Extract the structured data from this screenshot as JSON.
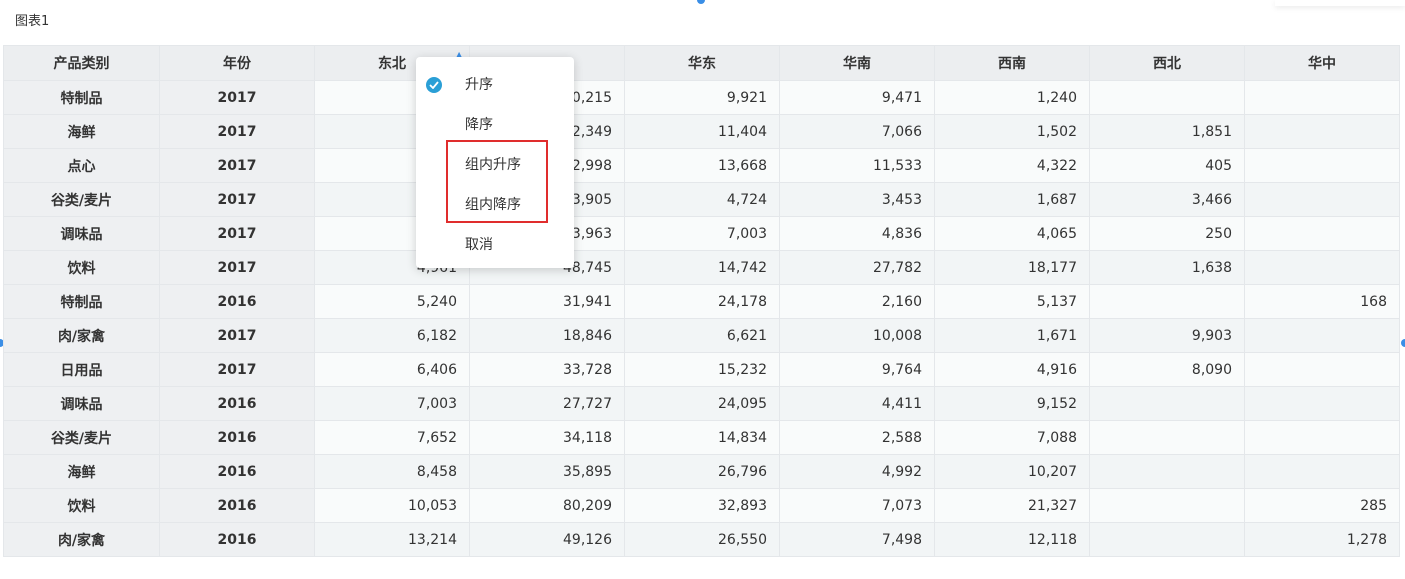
{
  "chart_title": "图表1",
  "colors": {
    "accent": "#2a9fd6",
    "highlight": "#e02d2d"
  },
  "columns": [
    "产品类别",
    "年份",
    "东北",
    "",
    "华东",
    "华南",
    "西南",
    "西北",
    "华中"
  ],
  "rows": [
    [
      "特制品",
      "2017",
      "",
      "0,215",
      "9,921",
      "9,471",
      "1,240",
      "",
      ""
    ],
    [
      "海鲜",
      "2017",
      "",
      "2,349",
      "11,404",
      "7,066",
      "1,502",
      "1,851",
      ""
    ],
    [
      "点心",
      "2017",
      "",
      "2,998",
      "13,668",
      "11,533",
      "4,322",
      "405",
      ""
    ],
    [
      "谷类/麦片",
      "2017",
      "",
      "3,905",
      "4,724",
      "3,453",
      "1,687",
      "3,466",
      ""
    ],
    [
      "调味品",
      "2017",
      "",
      "3,963",
      "7,003",
      "4,836",
      "4,065",
      "250",
      ""
    ],
    [
      "饮料",
      "2017",
      "4,961",
      "48,745",
      "14,742",
      "27,782",
      "18,177",
      "1,638",
      ""
    ],
    [
      "特制品",
      "2016",
      "5,240",
      "31,941",
      "24,178",
      "2,160",
      "5,137",
      "",
      "168"
    ],
    [
      "肉/家禽",
      "2017",
      "6,182",
      "18,846",
      "6,621",
      "10,008",
      "1,671",
      "9,903",
      ""
    ],
    [
      "日用品",
      "2017",
      "6,406",
      "33,728",
      "15,232",
      "9,764",
      "4,916",
      "8,090",
      ""
    ],
    [
      "调味品",
      "2016",
      "7,003",
      "27,727",
      "24,095",
      "4,411",
      "9,152",
      "",
      ""
    ],
    [
      "谷类/麦片",
      "2016",
      "7,652",
      "34,118",
      "14,834",
      "2,588",
      "7,088",
      "",
      ""
    ],
    [
      "海鲜",
      "2016",
      "8,458",
      "35,895",
      "26,796",
      "4,992",
      "10,207",
      "",
      ""
    ],
    [
      "饮料",
      "2016",
      "10,053",
      "80,209",
      "32,893",
      "7,073",
      "21,327",
      "",
      "285"
    ],
    [
      "肉/家禽",
      "2016",
      "13,214",
      "49,126",
      "26,550",
      "7,498",
      "12,118",
      "",
      "1,278"
    ]
  ],
  "sort_menu": {
    "items": [
      {
        "label": "升序",
        "checked": true
      },
      {
        "label": "降序",
        "checked": false
      },
      {
        "label": "组内升序",
        "checked": false
      },
      {
        "label": "组内降序",
        "checked": false
      },
      {
        "label": "取消",
        "checked": false
      }
    ]
  }
}
